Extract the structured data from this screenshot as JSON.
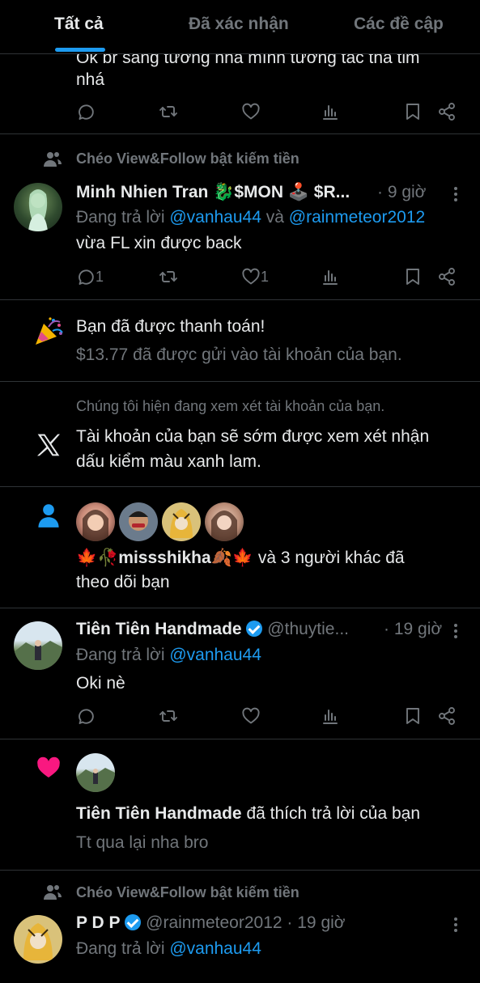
{
  "tabs": [
    {
      "label": "Tất cả"
    },
    {
      "label": "Đã xác nhận"
    },
    {
      "label": "Các đề cập"
    }
  ],
  "post0": {
    "line1": "Ok br sang tương nha mình tương tác thả tim",
    "line2": "nhá"
  },
  "post1": {
    "context": "Chéo View&Follow bật kiếm tiền",
    "author": "Minh Nhien Tran 🐉$MON 🕹️ $R...",
    "time": "· 9 giờ",
    "reply_prefix": "Đang trả lời",
    "reply_to1": "@vanhau44",
    "reply_and": "và",
    "reply_to2": "@rainmeteor2012",
    "body": "vừa FL xin được back",
    "reply_count": "1",
    "like_count": "1"
  },
  "payout": {
    "title": "Bạn đã được thanh toán!",
    "detail": "$13.77 đã được gửi vào tài khoản của bạn.",
    "icon": "party-popper-icon"
  },
  "review": {
    "subtitle": "Chúng tôi hiện đang xem xét tài khoản của bạn.",
    "line1": "Tài khoản của bạn sẽ sớm được xem xét nhận",
    "line2": "dấu kiểm màu xanh lam."
  },
  "follow": {
    "name": "🍁🥀missshikha🍂🍁",
    "rest": "và 3 người khác đã",
    "line2": "theo dõi bạn"
  },
  "post2": {
    "author": "Tiên Tiên Handmade",
    "handle": "@thuytie...",
    "time": "· 19 giờ",
    "reply_prefix": "Đang trả lời",
    "reply_to": "@vanhau44",
    "body": "Oki nè"
  },
  "like_notice": {
    "name": "Tiên Tiên Handmade",
    "action": "đã thích trả lời của bạn",
    "quote": "Tt qua lại nha bro"
  },
  "post3": {
    "context": "Chéo View&Follow bật kiếm tiền",
    "author": "P D P",
    "handle": "@rainmeteor2012",
    "time": "· 19 giờ",
    "reply_prefix": "Đang trả lời",
    "reply_to": "@vanhau44"
  },
  "colors": {
    "accent": "#1d9bf0",
    "like": "#f91880",
    "muted": "#71767b",
    "text": "#e7e9ea",
    "divider": "#2f3336"
  }
}
